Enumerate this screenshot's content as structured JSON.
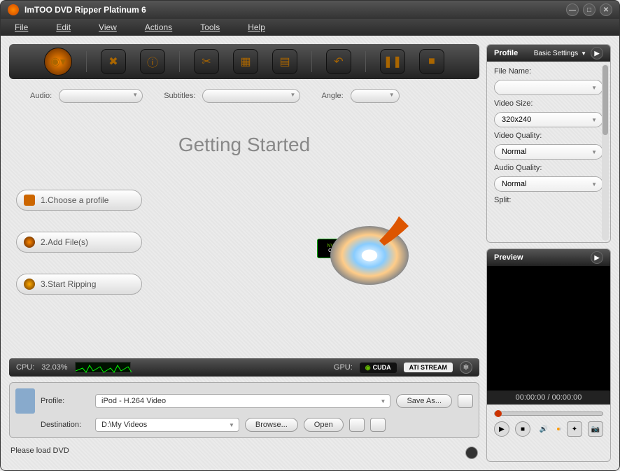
{
  "app": {
    "title": "ImTOO DVD Ripper Platinum 6"
  },
  "menu": {
    "file": "File",
    "edit": "Edit",
    "view": "View",
    "actions": "Actions",
    "tools": "Tools",
    "help": "Help"
  },
  "selectors": {
    "audio_label": "Audio:",
    "subtitles_label": "Subtitles:",
    "angle_label": "Angle:"
  },
  "getting_started": "Getting Started",
  "steps": {
    "s1": "1.Choose a profile",
    "s2": "2.Add File(s)",
    "s3": "3.Start Ripping"
  },
  "badges": {
    "nvidia": "NVIDIA",
    "cuda": "CUDA"
  },
  "status": {
    "cpu_label": "CPU:",
    "cpu_value": "32.03%",
    "gpu_label": "GPU:",
    "cuda": "CUDA",
    "ati": "ATI STREAM"
  },
  "bottom": {
    "profile_label": "Profile:",
    "profile_value": "iPod - H.264 Video",
    "saveas": "Save As...",
    "destination_label": "Destination:",
    "destination_value": "D:\\My Videos",
    "browse": "Browse...",
    "open": "Open"
  },
  "footer": {
    "msg": "Please load DVD"
  },
  "profile_panel": {
    "header": "Profile",
    "basic": "Basic Settings",
    "filename_label": "File Name:",
    "filename_value": "",
    "videosize_label": "Video Size:",
    "videosize_value": "320x240",
    "videoquality_label": "Video Quality:",
    "videoquality_value": "Normal",
    "audioquality_label": "Audio Quality:",
    "audioquality_value": "Normal",
    "split_label": "Split:"
  },
  "preview": {
    "header": "Preview",
    "timecode": "00:00:00 / 00:00:00"
  }
}
